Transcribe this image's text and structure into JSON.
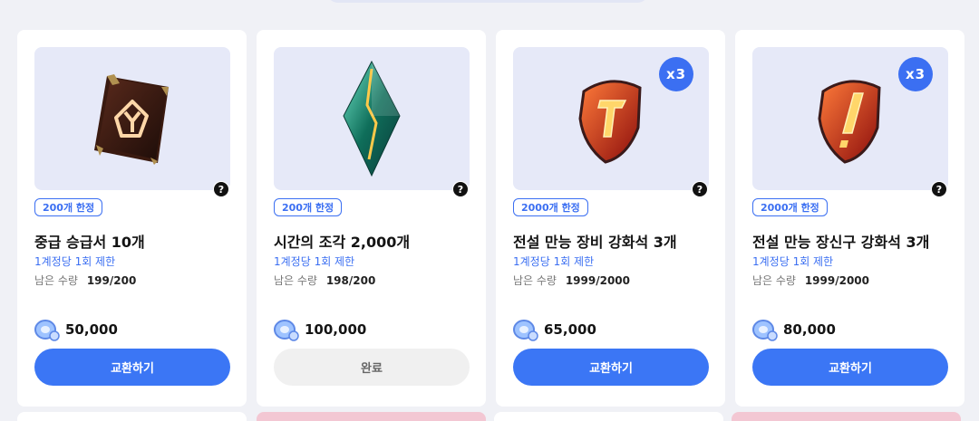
{
  "items": [
    {
      "name": "중급 승급서 10개",
      "limit_tag": "200개 한정",
      "per_account": "1계정당 1회 제한",
      "remain_label": "남은 수량",
      "remain_value": "199/200",
      "price": "50,000",
      "action": "교환하기",
      "icon": "book-icon",
      "badge": ""
    },
    {
      "name": "시간의 조각 2,000개",
      "limit_tag": "200개 한정",
      "per_account": "1계정당 1회 제한",
      "remain_label": "남은 수량",
      "remain_value": "198/200",
      "price": "100,000",
      "action": "완료",
      "icon": "crystal-icon",
      "badge": ""
    },
    {
      "name": "전설 만능 장비 강화석 3개",
      "limit_tag": "2000개 한정",
      "per_account": "1계정당 1회 제한",
      "remain_label": "남은 수량",
      "remain_value": "1999/2000",
      "price": "65,000",
      "action": "교환하기",
      "icon": "gem-icon",
      "badge": "x3"
    },
    {
      "name": "전설 만능 장신구 강화석 3개",
      "limit_tag": "2000개 한정",
      "per_account": "1계정당 1회 제한",
      "remain_label": "남은 수량",
      "remain_value": "1999/2000",
      "price": "80,000",
      "action": "교환하기",
      "icon": "gem-icon",
      "badge": "x3"
    }
  ],
  "help_glyph": "?",
  "colors": {
    "accent": "#3b76f5",
    "card_bg": "#ffffff",
    "thumb_bg": "#e6e9f8",
    "page_bg": "#f0f1f6"
  }
}
